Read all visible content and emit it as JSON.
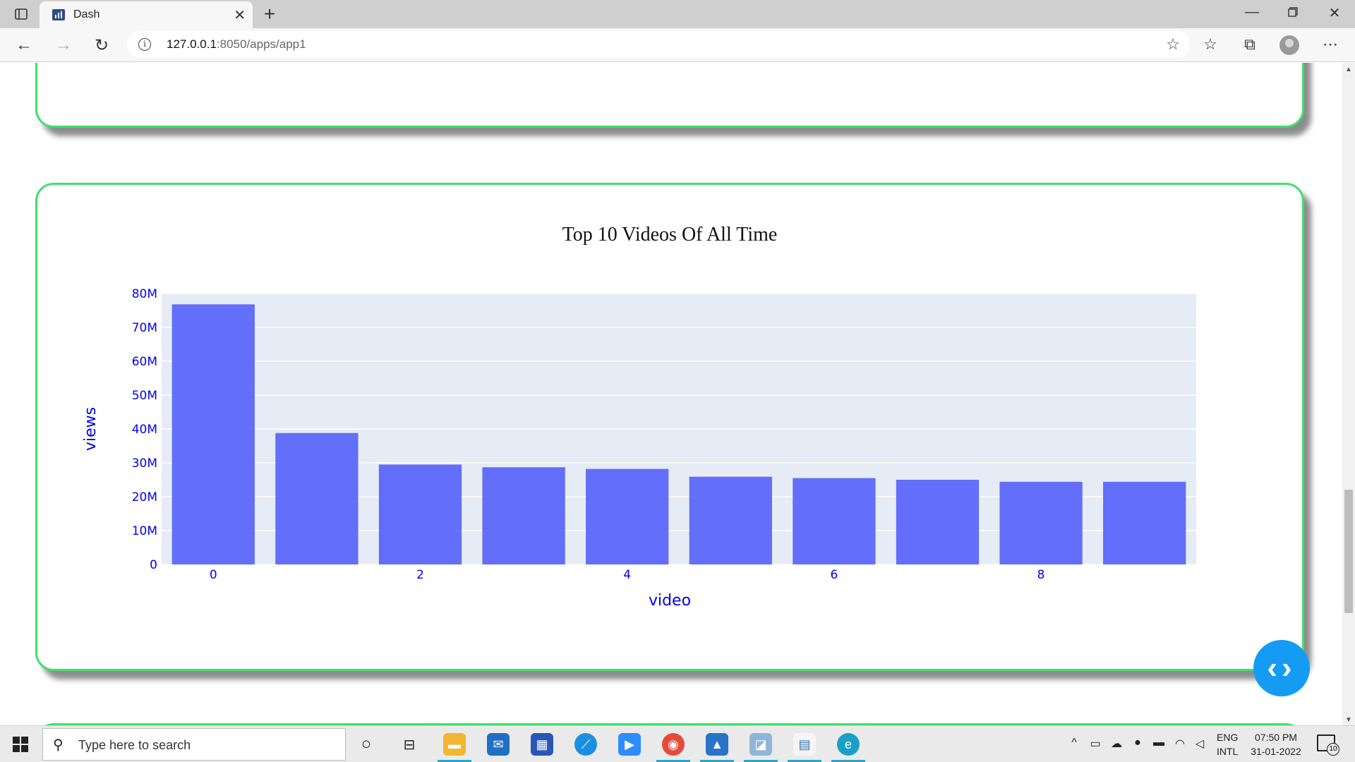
{
  "browser": {
    "tab_title": "Dash",
    "url_host": "127.0.0.1",
    "url_rest": ":8050/apps/app1"
  },
  "chart_data": {
    "type": "bar",
    "title": "Top 10 Videos Of All Time",
    "xlabel": "video",
    "ylabel": "views",
    "x": [
      0,
      1,
      2,
      3,
      4,
      5,
      6,
      7,
      8,
      9
    ],
    "values": [
      76800000,
      38800000,
      29500000,
      28700000,
      28200000,
      25900000,
      25500000,
      25000000,
      24400000,
      24400000
    ],
    "ylim": [
      0,
      80000000
    ],
    "ytick_values": [
      0,
      10000000,
      20000000,
      30000000,
      40000000,
      50000000,
      60000000,
      70000000,
      80000000
    ],
    "ytick_labels": [
      "0",
      "10M",
      "20M",
      "30M",
      "40M",
      "50M",
      "60M",
      "70M",
      "80M"
    ],
    "xtick_values": [
      0,
      2,
      4,
      6,
      8
    ],
    "xtick_labels": [
      "0",
      "2",
      "4",
      "6",
      "8"
    ],
    "bar_color": "#636efa",
    "plot_bg": "#e5ecf6",
    "grid": true,
    "font_color": "#0000ee"
  },
  "taskbar": {
    "search_placeholder": "Type here to search",
    "lang_top": "ENG",
    "lang_bottom": "INTL",
    "time": "07:50 PM",
    "date": "31-01-2022",
    "notification_count": "10"
  },
  "colors": {
    "card_border": "#3de06b",
    "fab": "#149cf5"
  }
}
